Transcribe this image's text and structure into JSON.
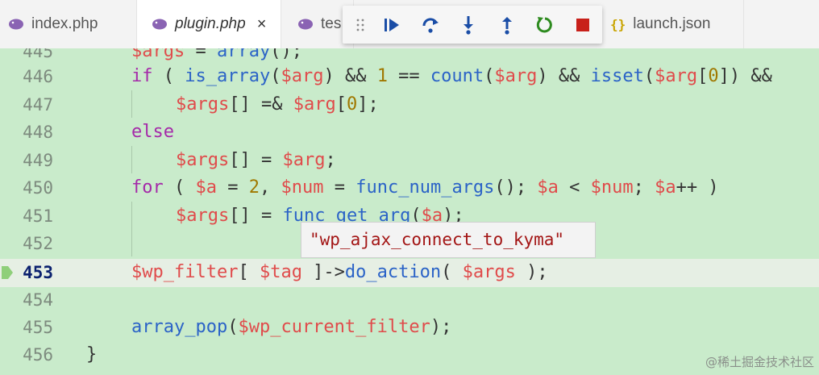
{
  "tabs": [
    {
      "label": "index.php"
    },
    {
      "label": "plugin.php",
      "close": "×"
    },
    {
      "label": "tes"
    },
    {
      "label": "launch.json",
      "icon_text": "{}"
    }
  ],
  "colors": {
    "editor_bg": "#c9ebcb",
    "keyword": "#a52aa9",
    "variable": "#e04b4b",
    "function": "#2b63c7",
    "number": "#a07800",
    "string": "#a31515",
    "stop": "#c8201a",
    "restart": "#2e8b1f",
    "debug_blue": "#1a4da6"
  },
  "debug_toolbar": {
    "buttons": [
      "continue-icon",
      "step-over-icon",
      "step-into-icon",
      "step-out-icon",
      "restart-icon",
      "stop-icon"
    ]
  },
  "editor": {
    "lines": [
      {
        "n": "445"
      },
      {
        "n": "446"
      },
      {
        "n": "447"
      },
      {
        "n": "448"
      },
      {
        "n": "449"
      },
      {
        "n": "450"
      },
      {
        "n": "451"
      },
      {
        "n": "452"
      },
      {
        "n": "453"
      },
      {
        "n": "454"
      },
      {
        "n": "455"
      },
      {
        "n": "456"
      }
    ],
    "tokens": {
      "l445": [
        "$args",
        " = ",
        "array",
        "();"
      ],
      "l446": [
        "if",
        " ( ",
        "is_array",
        "(",
        "$arg",
        ") && ",
        "1",
        " == ",
        "count",
        "(",
        "$arg",
        ") && ",
        "isset",
        "(",
        "$arg",
        "[",
        "0",
        "]) &&"
      ],
      "l447": [
        "$args",
        "[] =& ",
        "$arg",
        "[",
        "0",
        "];"
      ],
      "l448": [
        "else"
      ],
      "l449": [
        "$args",
        "[] = ",
        "$arg",
        ";"
      ],
      "l450": [
        "for",
        " ( ",
        "$a",
        " = ",
        "2",
        ", ",
        "$num",
        " = ",
        "func_num_args",
        "(); ",
        "$a",
        " < ",
        "$num",
        "; ",
        "$a",
        "++ )"
      ],
      "l451": [
        "$args",
        "[] = ",
        "func_get_arg",
        "(",
        "$a",
        ");"
      ],
      "l453": [
        "$wp_filter",
        "[ ",
        "$tag",
        " ]->",
        "do_action",
        "( ",
        "$args",
        " );"
      ],
      "l455": [
        "array_pop",
        "(",
        "$wp_current_filter",
        ");"
      ],
      "l456": [
        "}"
      ]
    }
  },
  "hover": {
    "value": "\"wp_ajax_connect_to_kyma\""
  },
  "watermark": "@稀土掘金技术社区"
}
